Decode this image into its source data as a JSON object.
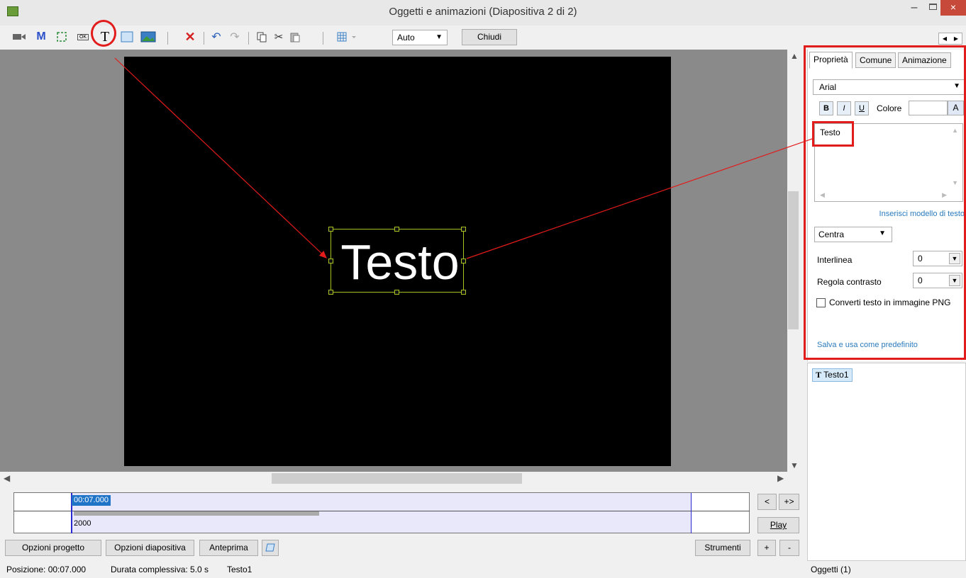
{
  "window": {
    "title": "Oggetti e animazioni  (Diapositiva 2 di 2)",
    "minimize": "–",
    "close": "×"
  },
  "toolbar": {
    "icons": [
      "video-icon",
      "mask-icon",
      "frame-icon",
      "button-icon",
      "text-icon",
      "rectangle-icon",
      "image-icon",
      "delete-icon",
      "undo-icon",
      "redo-icon",
      "copy-icon",
      "cut-icon",
      "paste-icon",
      "grid-icon"
    ],
    "text_tool": "T",
    "mask_tool": "M",
    "button_tool": "OK",
    "zoom_value": "Auto",
    "close_label": "Chiudi"
  },
  "canvas": {
    "slide_text": "Testo"
  },
  "timeline": {
    "time_label": "00:07.000",
    "value_label": "2000"
  },
  "timeline_buttons": {
    "prev": "<",
    "plus_arrow": "+>",
    "play": "Play",
    "add": "+",
    "remove": "-"
  },
  "bottom_buttons": {
    "project_options": "Opzioni progetto",
    "slide_options": "Opzioni diapositiva",
    "preview": "Anteprima",
    "tools": "Strumenti"
  },
  "status": {
    "position": "Posizione: 00:07.000",
    "duration": "Durata complessiva: 5.0 s",
    "selected": "Testo1",
    "objects": "Oggetti (1)"
  },
  "properties": {
    "tabs": [
      "Proprietà",
      "Comune",
      "Animazione"
    ],
    "font": "Arial",
    "bold": "B",
    "italic": "I",
    "underline": "U",
    "color_label": "Colore",
    "color_btn": "A",
    "text_value": "Testo",
    "insert_template": "Inserisci modello di testo",
    "alignment": "Centra",
    "line_spacing_label": "Interlinea",
    "line_spacing_value": "0",
    "contrast_label": "Regola contrasto",
    "contrast_value": "0",
    "png_label": "Converti testo in immagine PNG",
    "save_default": "Salva e usa come predefinito"
  },
  "objects": {
    "item_icon": "T",
    "item_label": "Testo1"
  },
  "colors": {
    "highlight": "#e21b1b",
    "selection": "#a8c020",
    "accent": "#1f74c8"
  }
}
